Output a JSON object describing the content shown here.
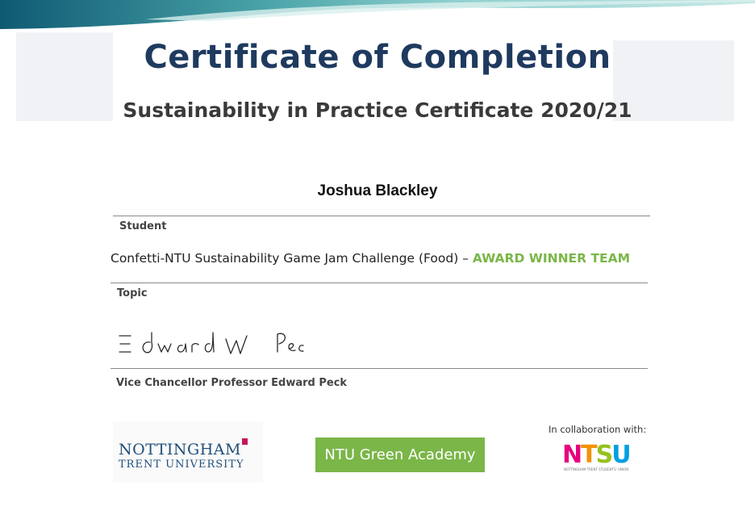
{
  "header": {
    "title": "Certificate of Completion",
    "subtitle": "Sustainability in Practice Certificate 2020/21"
  },
  "student": {
    "name": "Joshua Blackley",
    "label": "Student"
  },
  "topic": {
    "text": "Confetti-NTU Sustainability Game Jam Challenge (Food) – ",
    "highlight": "AWARD WINNER TEAM",
    "label": "Topic"
  },
  "signatory": {
    "signature_text": "Edward W Peck",
    "label": "Vice Chancellor Professor Edward Peck"
  },
  "logos": {
    "ntu_line1": "NOTTINGHAM",
    "ntu_line2": "TRENT UNIVERSITY",
    "green_academy": "NTU Green Academy",
    "collaboration": "In collaboration with:",
    "ntsu_letters": [
      "N",
      "T",
      "S",
      "U"
    ],
    "ntsu_subtext": "NOTTINGHAM TRENT STUDENTS' UNION"
  },
  "colors": {
    "title": "#1f3a5f",
    "award": "#7ab648",
    "green_academy_bg": "#7ab648",
    "ntu_blue": "#1f4f7a",
    "ntsu": [
      "#e6007e",
      "#f39200",
      "#95c11f",
      "#00a0e3"
    ]
  }
}
